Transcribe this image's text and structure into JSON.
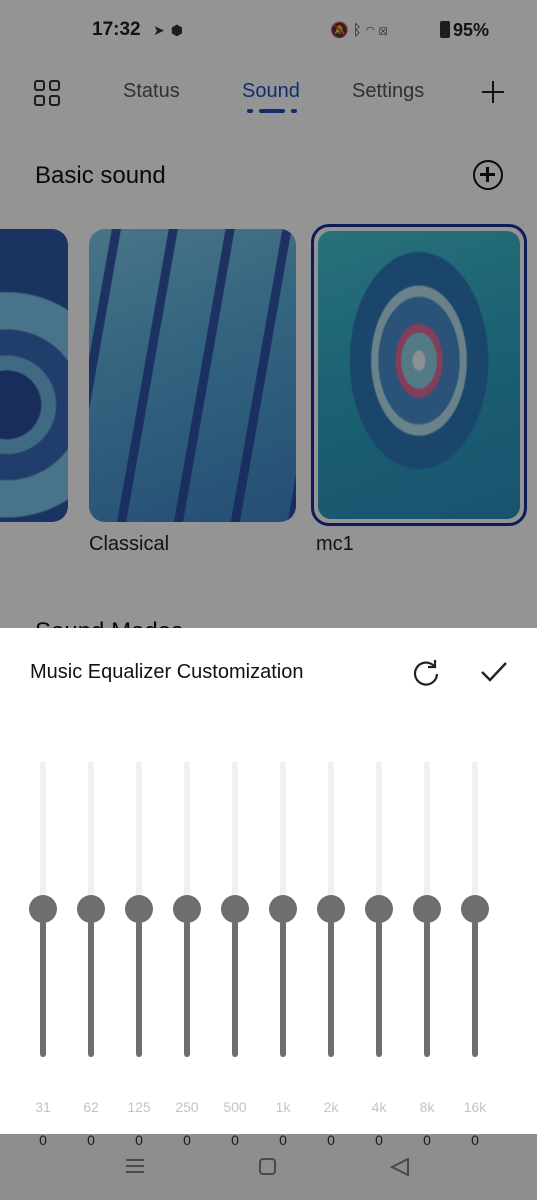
{
  "statusbar": {
    "time": "17:32",
    "left_icons": [
      "telegram-icon",
      "shield-app-icon"
    ],
    "right_icons": [
      "mute-icon",
      "bluetooth-icon",
      "wifi-icon",
      "x-sim-icon"
    ],
    "battery": "95%"
  },
  "tabs": [
    {
      "label": "Status",
      "active": false
    },
    {
      "label": "Sound",
      "active": true
    },
    {
      "label": "Settings",
      "active": false
    }
  ],
  "basic_sound": {
    "title": "Basic sound",
    "cards": [
      {
        "label": "",
        "selected": false
      },
      {
        "label": "Classical",
        "selected": false
      },
      {
        "label": "mc1",
        "selected": true
      }
    ]
  },
  "sound_modes_title_partial": "Sound Modes",
  "equalizer": {
    "title": "Music Equalizer Customization",
    "bands": [
      {
        "freq": "31",
        "gain": "0"
      },
      {
        "freq": "62",
        "gain": "0"
      },
      {
        "freq": "125",
        "gain": "0"
      },
      {
        "freq": "250",
        "gain": "0"
      },
      {
        "freq": "500",
        "gain": "0"
      },
      {
        "freq": "1k",
        "gain": "0"
      },
      {
        "freq": "2k",
        "gain": "0"
      },
      {
        "freq": "4k",
        "gain": "0"
      },
      {
        "freq": "8k",
        "gain": "0"
      },
      {
        "freq": "16k",
        "gain": "0"
      }
    ],
    "gain_range": [
      -10,
      10
    ]
  },
  "colors": {
    "accent": "#1f4fbf",
    "slider": "#6e6e6e",
    "track": "#f0f0f0"
  }
}
